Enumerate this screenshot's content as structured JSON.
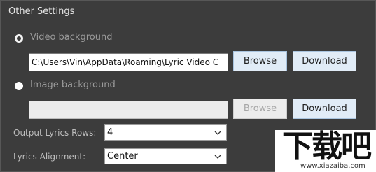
{
  "group": {
    "title": "Other Settings"
  },
  "video": {
    "radio_label": "Video background",
    "path_value": "C:\\Users\\Vin\\AppData\\Roaming\\Lyric Video C",
    "browse_label": "Browse",
    "download_label": "Download"
  },
  "image": {
    "radio_label": "Image background",
    "path_value": "",
    "browse_label": "Browse",
    "download_label": "Download"
  },
  "output_rows": {
    "label": "Output Lyrics Rows:",
    "value": "4"
  },
  "alignment": {
    "label": "Lyrics Alignment:",
    "value": "Center"
  },
  "watermark": {
    "logo_text": "下载吧",
    "url": "www.xiazaiba.com"
  },
  "colors": {
    "panel_bg": "#3c3c3c",
    "button_bg": "#e1ecf7",
    "label_text": "#9a9a9a"
  }
}
